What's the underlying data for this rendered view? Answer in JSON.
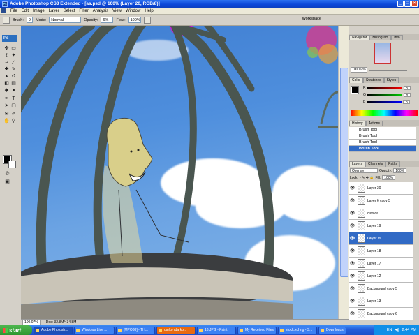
{
  "window": {
    "title": "Adobe Photoshop CS3 Extended - [aa.psd @ 100% (Layer 20, RGB/8)]"
  },
  "menu": [
    "File",
    "Edit",
    "Image",
    "Layer",
    "Select",
    "Filter",
    "Analysis",
    "View",
    "Window",
    "Help"
  ],
  "options": {
    "brush_label": "Brush:",
    "brush_size": "9",
    "mode_label": "Mode:",
    "mode_value": "Normal",
    "opacity_label": "Opacity:",
    "opacity_value": "6%",
    "flow_label": "Flow:",
    "flow_value": "100%",
    "workspace_label": "Workspace"
  },
  "toolbox": {
    "logo": "Ps"
  },
  "status": {
    "zoom": "100.07%",
    "doc": "Doc: 32.8M/434.8M"
  },
  "navigator": {
    "tabs": [
      "Navigator",
      "Histogram",
      "Info"
    ],
    "zoom": "100.07%"
  },
  "color_panel": {
    "tabs": [
      "Color",
      "Swatches",
      "Styles"
    ],
    "rows": [
      {
        "label": "R",
        "value": "0",
        "color": "#e33"
      },
      {
        "label": "G",
        "value": "0",
        "color": "#3c3"
      },
      {
        "label": "B",
        "value": "0",
        "color": "#33e"
      }
    ]
  },
  "history": {
    "tabs": [
      "History",
      "Actions"
    ],
    "items": [
      "Brush Tool",
      "Brush Tool",
      "Brush Tool",
      "Brush Tool"
    ]
  },
  "layers": {
    "tabs": [
      "Layers",
      "Channels",
      "Paths"
    ],
    "blend_mode": "Overlay",
    "opacity_label": "Opacity:",
    "opacity_value": "100%",
    "lock_label": "Lock:",
    "fill_label": "Fill:",
    "fill_value": "100%",
    "items": [
      {
        "name": "Layer 30"
      },
      {
        "name": "Layer 6 copy 5"
      },
      {
        "name": "cuvaca"
      },
      {
        "name": "Layer 19"
      },
      {
        "name": "Layer 20"
      },
      {
        "name": "Layer 18"
      },
      {
        "name": "Layer 17"
      },
      {
        "name": "Layer 12"
      },
      {
        "name": "Background copy 5"
      },
      {
        "name": "Layer 13"
      },
      {
        "name": "Background copy 6"
      }
    ]
  },
  "taskbar": {
    "start": "start",
    "tasks": [
      "Adobe Photosh...",
      "Windows Live ...",
      "[MPO88] - TH...",
      "darko rdarko...",
      "13.JPG - Paint",
      "My Received Files",
      "stock.xchng - S...",
      "Downloads"
    ],
    "lang": "EN",
    "time": "2:44 PM"
  },
  "colors": {
    "selection": "#316ac5",
    "sky_top": "#3f7ed2",
    "xp_blue": "#245edb"
  }
}
